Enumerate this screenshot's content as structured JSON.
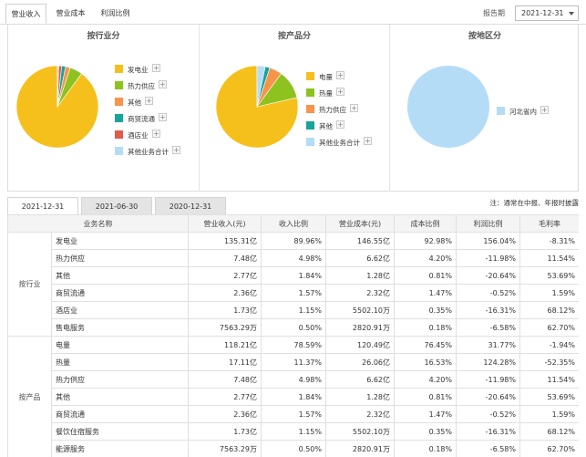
{
  "top_tabs": [
    "营业收入",
    "营业成本",
    "利润比例"
  ],
  "period": {
    "label": "报告期",
    "value": "2021-12-31"
  },
  "panels": [
    {
      "title": "按行业分",
      "items": [
        {
          "label": "发电业",
          "color": "#f5c01b",
          "value": 89.96
        },
        {
          "label": "热力供应",
          "color": "#8dc21f",
          "value": 4.98
        },
        {
          "label": "其他",
          "color": "#f7944a",
          "value": 1.84
        },
        {
          "label": "商贸流通",
          "color": "#16a49b",
          "value": 1.57
        },
        {
          "label": "酒店业",
          "color": "#e05b4a",
          "value": 1.15
        },
        {
          "label": "其他业务合计",
          "color": "#b5dcf7",
          "value": 0.5
        }
      ]
    },
    {
      "title": "按产品分",
      "items": [
        {
          "label": "电量",
          "color": "#f5c01b",
          "value": 78.59
        },
        {
          "label": "热量",
          "color": "#8dc21f",
          "value": 11.37
        },
        {
          "label": "热力供应",
          "color": "#f7944a",
          "value": 4.98
        },
        {
          "label": "其他",
          "color": "#16a49b",
          "value": 1.84
        },
        {
          "label": "其他业务合计",
          "color": "#b5dcf7",
          "value": 3.22
        }
      ]
    },
    {
      "title": "按地区分",
      "items": [
        {
          "label": "河北省内",
          "color": "#b5dcf7",
          "value": 100
        }
      ]
    }
  ],
  "tabs2": [
    "2021-12-31",
    "2021-06-30",
    "2020-12-31"
  ],
  "note": "注：通常在中报、年报时披露",
  "table": {
    "headers": [
      "业务名称",
      "营业收入(元)",
      "收入比例",
      "营业成本(元)",
      "成本比例",
      "利润比例",
      "毛利率"
    ],
    "groups": [
      {
        "name": "按行业",
        "rows": [
          [
            "发电业",
            "135.31亿",
            "89.96%",
            "146.55亿",
            "92.98%",
            "156.04%",
            "-8.31%"
          ],
          [
            "热力供应",
            "7.48亿",
            "4.98%",
            "6.62亿",
            "4.20%",
            "-11.98%",
            "11.54%"
          ],
          [
            "其他",
            "2.77亿",
            "1.84%",
            "1.28亿",
            "0.81%",
            "-20.64%",
            "53.69%"
          ],
          [
            "商贸流通",
            "2.36亿",
            "1.57%",
            "2.32亿",
            "1.47%",
            "-0.52%",
            "1.59%"
          ],
          [
            "酒店业",
            "1.73亿",
            "1.15%",
            "5502.10万",
            "0.35%",
            "-16.31%",
            "68.12%"
          ],
          [
            "售电服务",
            "7563.29万",
            "0.50%",
            "2820.91万",
            "0.18%",
            "-6.58%",
            "62.70%"
          ]
        ]
      },
      {
        "name": "按产品",
        "rows": [
          [
            "电量",
            "118.21亿",
            "78.59%",
            "120.49亿",
            "76.45%",
            "31.77%",
            "-1.94%"
          ],
          [
            "热量",
            "17.11亿",
            "11.37%",
            "26.06亿",
            "16.53%",
            "124.28%",
            "-52.35%"
          ],
          [
            "热力供应",
            "7.48亿",
            "4.98%",
            "6.62亿",
            "4.20%",
            "-11.98%",
            "11.54%"
          ],
          [
            "其他",
            "2.77亿",
            "1.84%",
            "1.28亿",
            "0.81%",
            "-20.64%",
            "53.69%"
          ],
          [
            "商贸流通",
            "2.36亿",
            "1.57%",
            "2.32亿",
            "1.47%",
            "-0.52%",
            "1.59%"
          ],
          [
            "餐饮住宿服务",
            "1.73亿",
            "1.15%",
            "5502.10万",
            "0.35%",
            "-16.31%",
            "68.12%"
          ],
          [
            "能源服务",
            "7563.29万",
            "0.50%",
            "2820.91万",
            "0.18%",
            "-6.58%",
            "62.70%"
          ]
        ]
      }
    ]
  }
}
